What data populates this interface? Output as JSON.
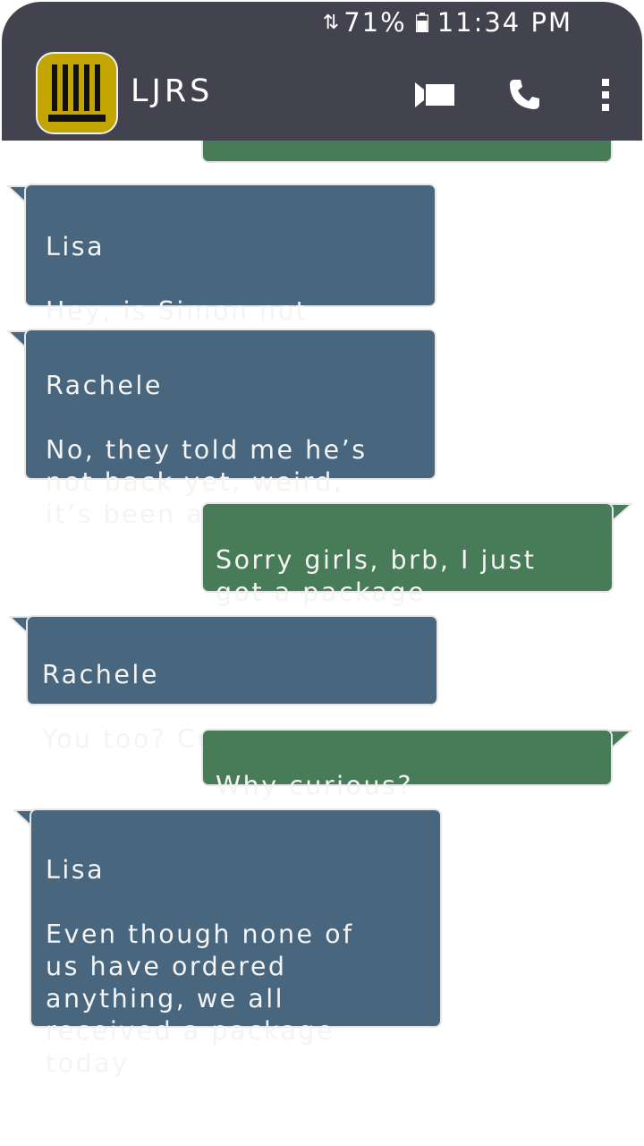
{
  "status_bar": {
    "battery": "71%",
    "time": "11:34 PM"
  },
  "header": {
    "title": "LJRS"
  },
  "icons": {
    "signal": "data-arrows-icon",
    "battery": "battery-icon",
    "avatar": "bars-logo-icon",
    "video": "video-camera-icon",
    "call": "phone-icon",
    "menu": "more-vert-icon"
  },
  "colors": {
    "header_bg": "#42434f",
    "incoming_bubble": "#48667d",
    "outgoing_bubble": "#487c59",
    "avatar_bg": "#c2a500"
  },
  "messages": [
    {
      "dir": "in",
      "sender": "Lisa",
      "text": "Hey, is Simon not\nback yet?"
    },
    {
      "dir": "in",
      "sender": "Rachele",
      "text": "No, they told me he’s\nnot back yet, weird,\nit’s been an hour"
    },
    {
      "dir": "out",
      "text": "Sorry girls, brb, I just\ngot a package"
    },
    {
      "dir": "in",
      "sender": "Rachele",
      "text": "You too? Curious"
    },
    {
      "dir": "out",
      "text": "Why curious?"
    },
    {
      "dir": "in",
      "sender": "Lisa",
      "text": "Even though none of\nus have ordered\nanything, we all\nreceived a package\ntoday"
    }
  ]
}
